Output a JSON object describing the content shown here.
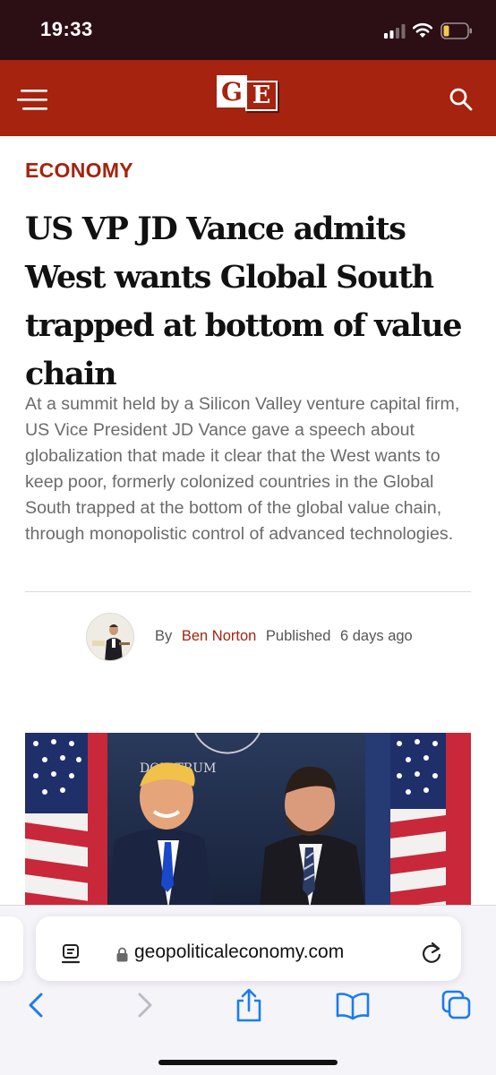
{
  "status_bar": {
    "time": "19:33",
    "icons": [
      "signal-icon",
      "wifi-icon",
      "battery-icon"
    ],
    "battery_color": "#f2c94c"
  },
  "site_header": {
    "background_color": "#a5230f",
    "logo_letters": [
      "G",
      "E"
    ],
    "icons": [
      "menu-icon",
      "search-icon"
    ]
  },
  "article": {
    "category": "ECONOMY",
    "headline_lines": [
      "US VP JD Vance admits",
      "West wants Global South",
      "trapped at bottom of value",
      "chain"
    ],
    "summary": "At a summit held by a Silicon Valley venture capital firm, US Vice President JD Vance gave a speech about globalization that made it clear that the West wants to keep poor, formerly colonized countries in the Global South trapped at the bottom of the global value chain, through monopolistic control of advanced technologies.",
    "byline": {
      "by_label": "By",
      "author": "Ben Norton",
      "published_label": "Published",
      "published_ago": "6 days ago"
    },
    "featured_image": {
      "description_icon": "photo-two-men-flags",
      "backdrop_text": "DON    TRUM"
    }
  },
  "browser": {
    "url": "geopoliticaleconomy.com",
    "icons": [
      "reader-icon",
      "lock-icon",
      "reload-icon"
    ],
    "toolbar": [
      "back-icon",
      "forward-icon",
      "share-icon",
      "bookmarks-icon",
      "tabs-icon"
    ],
    "accent_color": "#1a7cf0"
  }
}
